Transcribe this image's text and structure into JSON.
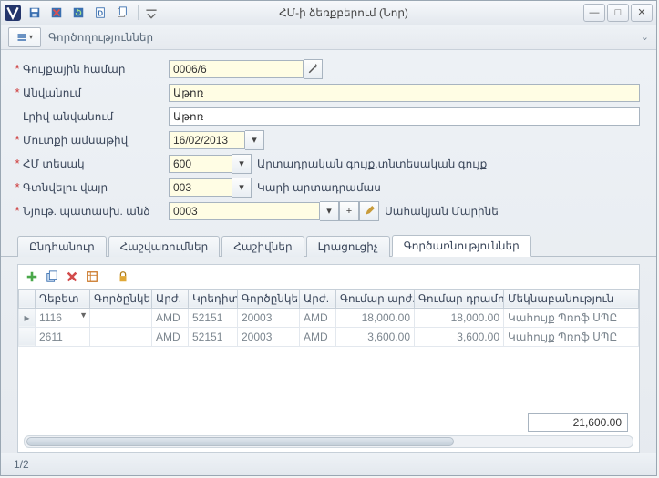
{
  "window": {
    "title": "ՀՄ-ի ձեռքբերում (Նոր)",
    "section_label": "Գործողություններ",
    "status": "1/2"
  },
  "form": {
    "inventory_number": {
      "label": "Գույքային համար",
      "value": "0006/6",
      "required": true
    },
    "name": {
      "label": "Անվանում",
      "value": "Աթոռ",
      "required": true
    },
    "full_name": {
      "label": "Լրիվ անվանում",
      "value": "Աթոռ",
      "required": false
    },
    "entry_date": {
      "label": "Մուտքի ամսաթիվ",
      "value": "16/02/2013",
      "required": true
    },
    "hm_type": {
      "label": "ՀՄ տեսակ",
      "value": "600",
      "desc": "Արտադրական գույք,տնտեսական գույք",
      "required": true
    },
    "location": {
      "label": "Գտնվելու վայր",
      "value": "003",
      "desc": "Կարի արտադրամաս",
      "required": true
    },
    "responsible": {
      "label": "Նյութ. պատասխ. անձ",
      "value": "0003",
      "desc": "Սահակյան Մարինե",
      "required": true
    }
  },
  "tabs": [
    {
      "id": "general",
      "label": "Ընդհանուր"
    },
    {
      "id": "reval",
      "label": "Հաշվառումներ"
    },
    {
      "id": "accounts",
      "label": "Հաշիվներ"
    },
    {
      "id": "extra",
      "label": "Լրացուցիչ"
    },
    {
      "id": "ops",
      "label": "Գործառնություններ",
      "active": true
    }
  ],
  "grid": {
    "columns": [
      "Դեբետ",
      "Գործընկեր",
      "Արժ.",
      "Կրեդիտ",
      "Գործընկեր",
      "Արժ.",
      "Գումար արժ.",
      "Գումար դրամով",
      "Մեկնաբանություն"
    ],
    "rows": [
      {
        "debit": "1116",
        "partner1": "",
        "cur1": "AMD",
        "credit": "52151",
        "partner2": "20003",
        "cur2": "AMD",
        "amount_cur": "18,000.00",
        "amount_dram": "18,000.00",
        "note": "Կահույք Պռոֆ ՍՊԸ",
        "active": true
      },
      {
        "debit": "2611",
        "partner1": "",
        "cur1": "AMD",
        "credit": "52151",
        "partner2": "20003",
        "cur2": "AMD",
        "amount_cur": "3,600.00",
        "amount_dram": "3,600.00",
        "note": "Կահույք Պռոֆ ՍՊԸ",
        "active": false
      }
    ],
    "total": "21,600.00"
  }
}
